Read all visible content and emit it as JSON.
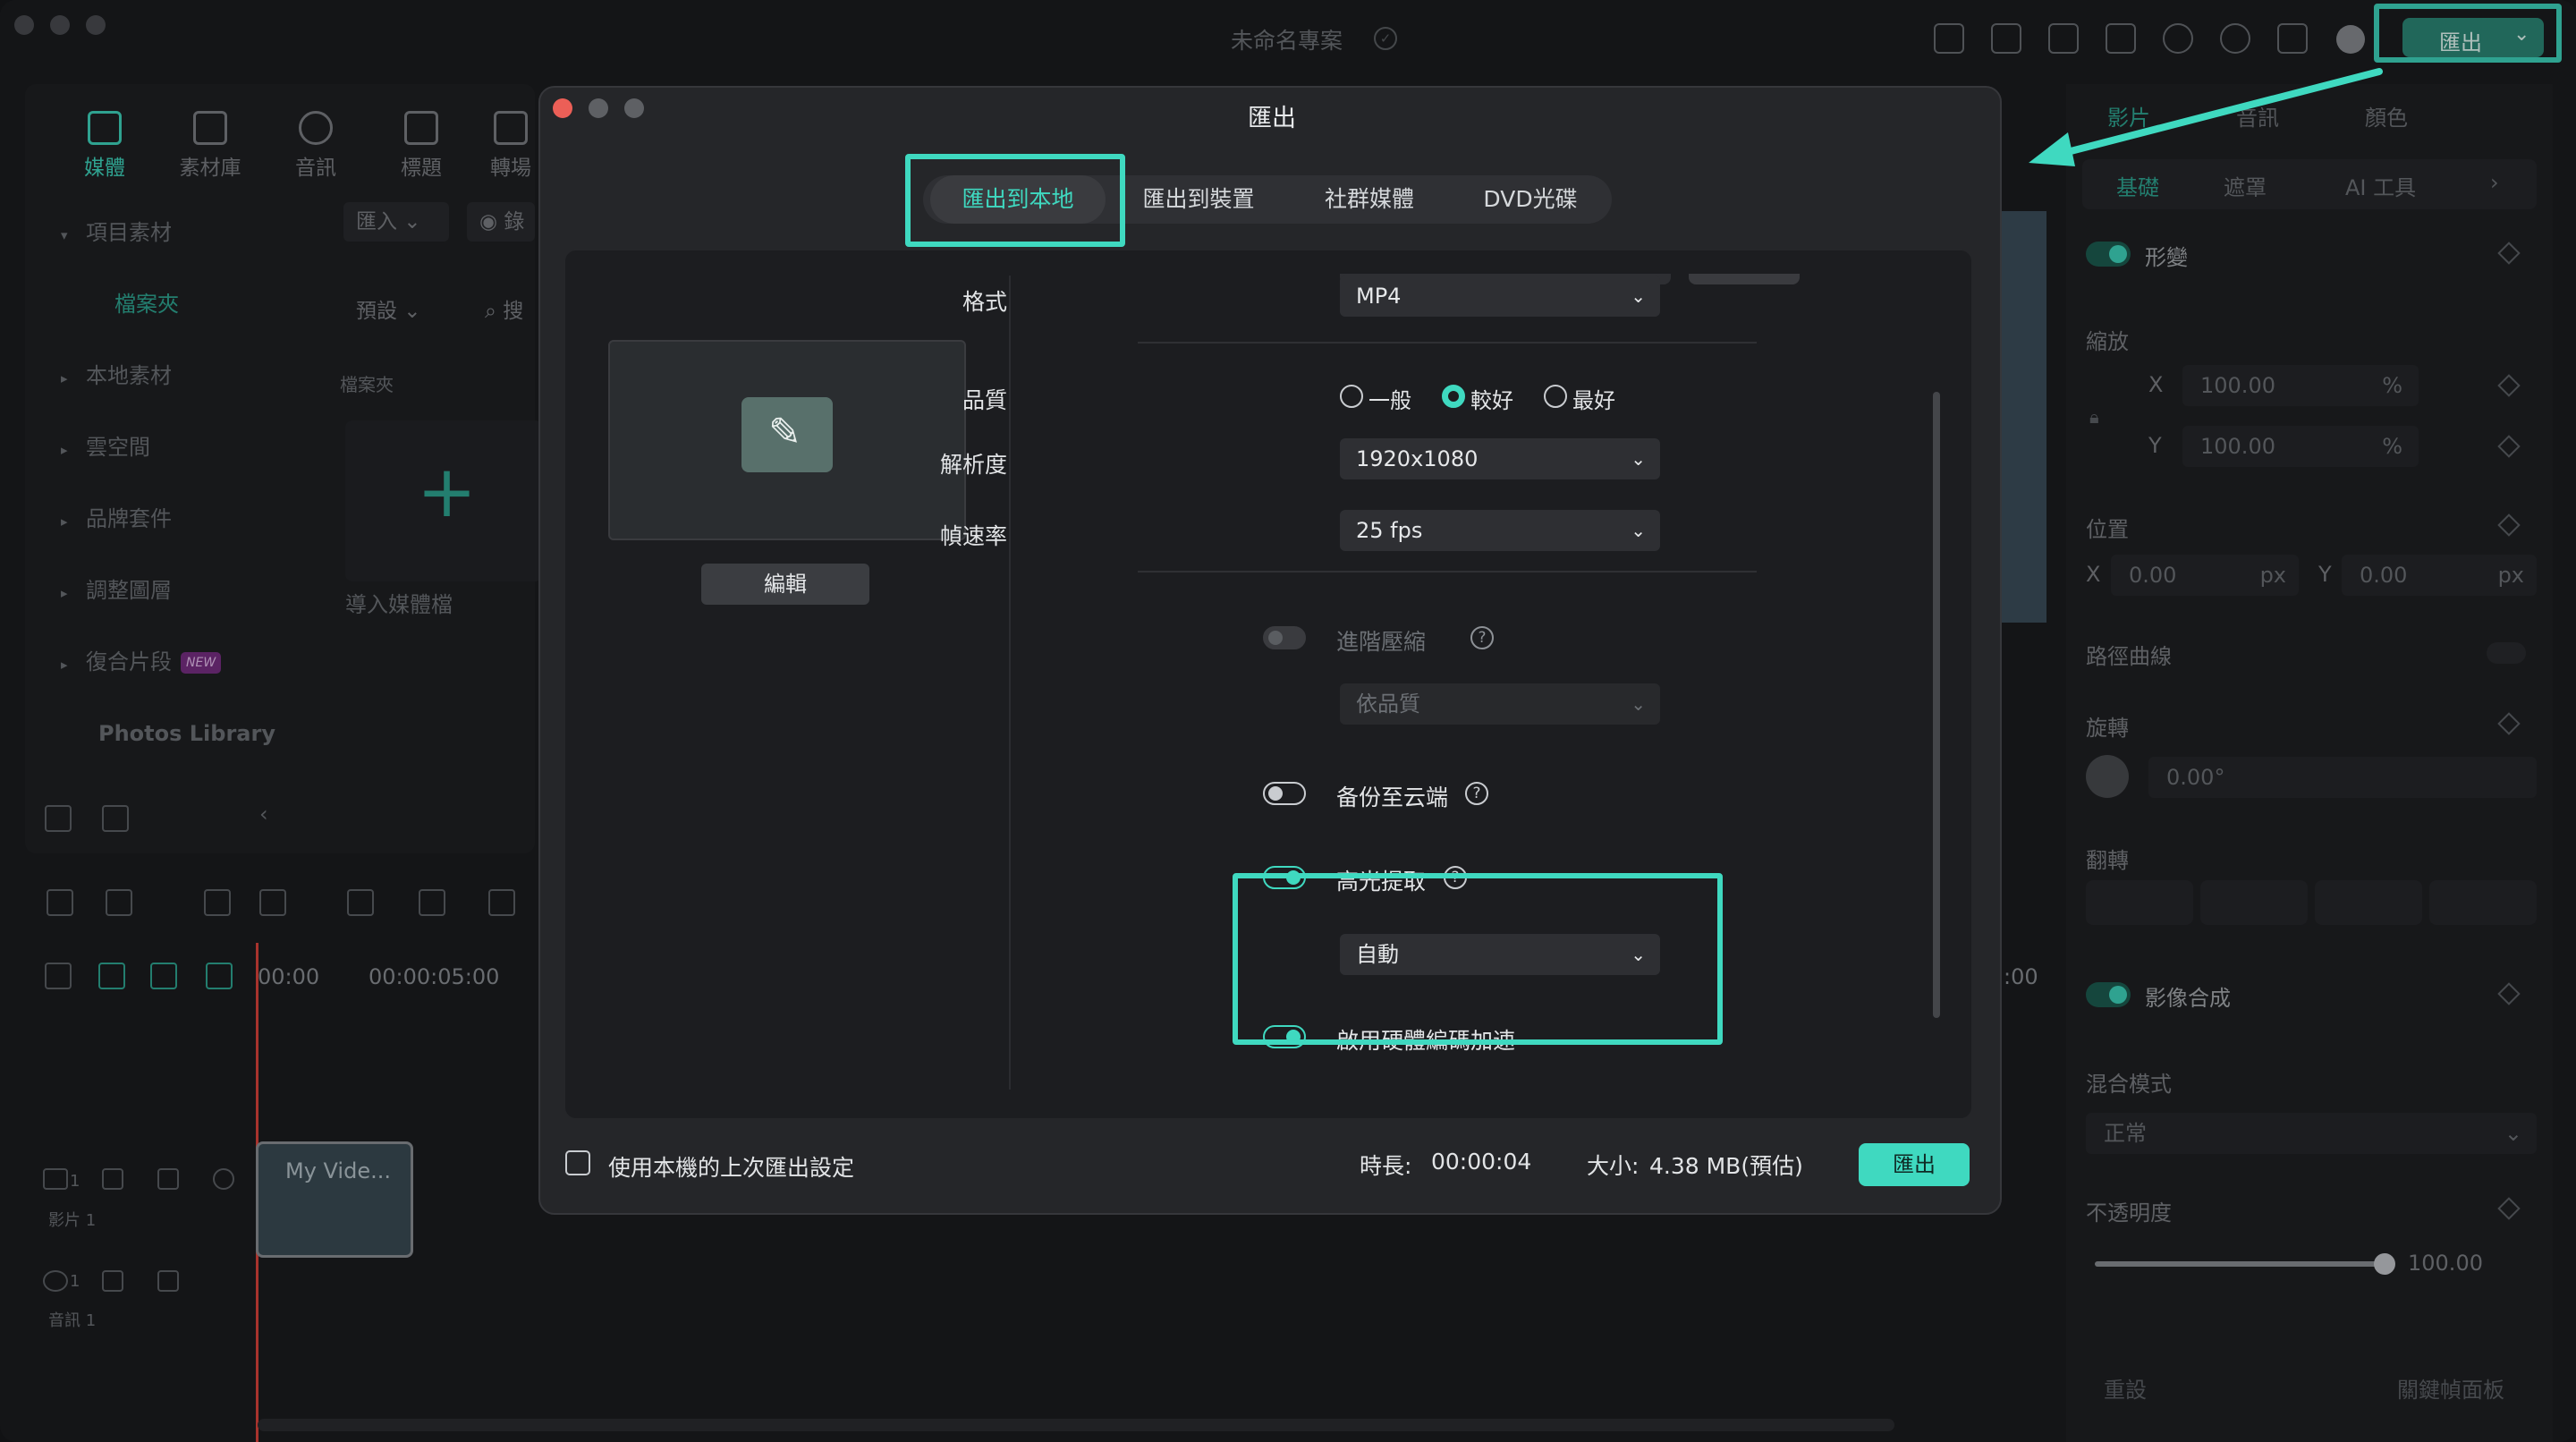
{
  "app": {
    "project_title": "未命名專案",
    "export_button": "匯出",
    "accent": "#3fd9c0",
    "highlight": "#3fd9c0"
  },
  "left_panel": {
    "tabs": [
      {
        "label": "媒體",
        "icon": "media-icon"
      },
      {
        "label": "素材庫",
        "icon": "stock-icon"
      },
      {
        "label": "音訊",
        "icon": "music-icon"
      },
      {
        "label": "標題",
        "icon": "title-icon"
      },
      {
        "label": "轉場",
        "icon": "transition-icon"
      }
    ],
    "sidebar": [
      "項目素材",
      "檔案夾",
      "本地素材",
      "雲空間",
      "品牌套件",
      "調整圖層",
      "復合片段",
      "Photos Library"
    ],
    "new_badge": "NEW",
    "import_dropdown": "匯入",
    "record_label": "錄",
    "preset_dropdown": "預設",
    "search_placeholder": "搜",
    "folder_header": "檔案夾",
    "import_media": "導入媒體檔"
  },
  "timeline": {
    "time_start": "00:00",
    "time_5s": "00:00:05:00",
    "time_right": ":00",
    "clip_name": "My Vide...",
    "video_track": "影片 1",
    "audio_track": "音訊 1",
    "video_track_num": "1",
    "audio_track_num": "1"
  },
  "right_panel": {
    "tabs": [
      "影片",
      "音訊",
      "顏色"
    ],
    "subtabs": [
      "基礎",
      "遮罩",
      "AI 工具"
    ],
    "transform": "形變",
    "scale": "縮放",
    "scale_x_axis": "X",
    "scale_y_axis": "Y",
    "scale_x": "100.00",
    "scale_y": "100.00",
    "percent": "%",
    "position": "位置",
    "pos_x_axis": "X",
    "pos_y_axis": "Y",
    "pos_x": "0.00",
    "pos_y": "0.00",
    "px": "px",
    "path_curve": "路徑曲線",
    "rotate": "旋轉",
    "rotate_value": "0.00°",
    "flip": "翻轉",
    "compositing": "影像合成",
    "blend_mode": "混合模式",
    "blend_value": "正常",
    "opacity": "不透明度",
    "opacity_value": "100.00",
    "reset": "重設",
    "keyframe_panel": "關鍵幀面板"
  },
  "dialog": {
    "title": "匯出",
    "tabs": [
      "匯出到本地",
      "匯出到裝置",
      "社群媒體",
      "DVD光碟"
    ],
    "edit_button": "編輯",
    "format_label": "格式",
    "format_value": "MP4",
    "quality_label": "品質",
    "quality_options": [
      "一般",
      "較好",
      "最好"
    ],
    "quality_selected": "較好",
    "resolution_label": "解析度",
    "resolution_value": "1920x1080",
    "fps_label": "幀速率",
    "fps_value": "25 fps",
    "advanced_compress": "進階壓縮",
    "compress_mode": "依品質",
    "cloud_backup": "备份至云端",
    "highlight_extract": "高光提取",
    "highlight_mode": "自動",
    "hw_accel": "啟用硬體編碼加速",
    "help_symbol": "?",
    "use_last_settings": "使用本機的上次匯出設定",
    "duration_label": "時長:",
    "duration_value": "00:00:04",
    "size_label": "大小:",
    "size_value": "4.38 MB(預估)",
    "export_button": "匯出"
  }
}
